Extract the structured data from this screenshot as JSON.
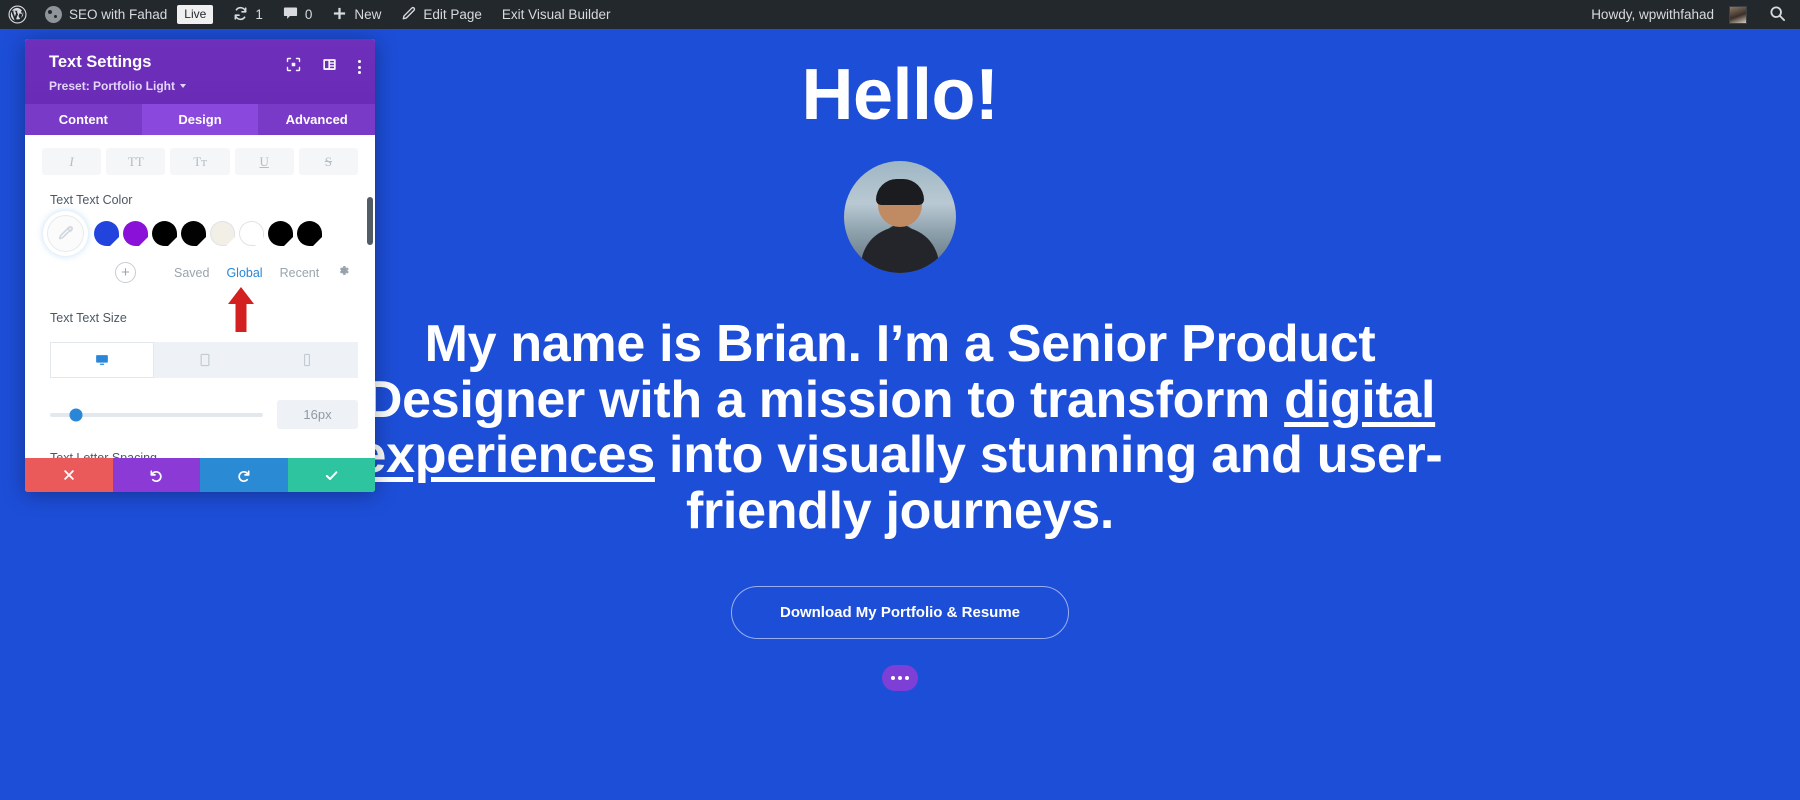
{
  "adminbar": {
    "wp_logo": "wordpress-logo-icon",
    "site_icon": "site-dashboard-icon",
    "site_name": "SEO with Fahad",
    "live_badge": "Live",
    "updates_icon": "updates-icon",
    "updates_count": "1",
    "comments_icon": "comments-icon",
    "comments_count": "0",
    "new_icon": "plus-icon",
    "new_label": "New",
    "edit_icon": "pencil-icon",
    "edit_label": "Edit Page",
    "exit_label": "Exit Visual Builder",
    "howdy": "Howdy, wpwithfahad",
    "avatar": "user-avatar",
    "search_icon": "search-icon"
  },
  "modal": {
    "title": "Text Settings",
    "preset_label": "Preset: Portfolio Light",
    "head_icons": [
      {
        "name": "focus-target-icon"
      },
      {
        "name": "layout-panel-icon"
      },
      {
        "name": "more-options-icon"
      }
    ],
    "tabs": [
      {
        "label": "Content",
        "active": false
      },
      {
        "label": "Design",
        "active": true
      },
      {
        "label": "Advanced",
        "active": false
      }
    ],
    "format_buttons": [
      {
        "name": "italic-button",
        "glyph": "I",
        "style": "it"
      },
      {
        "name": "uppercase-button",
        "glyph": "TT",
        "style": "tt"
      },
      {
        "name": "small-caps-button",
        "glyph": "Tᴛ",
        "style": "tc"
      },
      {
        "name": "underline-button",
        "glyph": "U",
        "style": "un"
      },
      {
        "name": "strikethrough-button",
        "glyph": "S",
        "style": "st"
      }
    ],
    "color_field": {
      "label": "Text Text Color",
      "picker_icon": "eyedropper-icon",
      "swatches": [
        {
          "name": "swatch-blue",
          "color": "#2244dd"
        },
        {
          "name": "swatch-purple",
          "color": "#8a12d8"
        },
        {
          "name": "swatch-black-1",
          "color": "#000000"
        },
        {
          "name": "swatch-black-2",
          "color": "#020202"
        },
        {
          "name": "swatch-cream",
          "color": "#f2efe6"
        },
        {
          "name": "swatch-white",
          "color": "#ffffff"
        },
        {
          "name": "swatch-black-3",
          "color": "#000000"
        },
        {
          "name": "swatch-black-4",
          "color": "#000000"
        }
      ],
      "add_button": "+",
      "source_tabs": [
        {
          "label": "Saved",
          "active": false
        },
        {
          "label": "Global",
          "active": true
        },
        {
          "label": "Recent",
          "active": false
        }
      ],
      "settings_icon": "gear-icon",
      "active_color": "#2a86d8"
    },
    "size_field": {
      "label": "Text Text Size",
      "devices": [
        {
          "name": "desktop-icon",
          "active": true
        },
        {
          "name": "tablet-icon",
          "active": false
        },
        {
          "name": "phone-icon",
          "active": false
        }
      ],
      "slider_percent": 12,
      "value": "16px"
    },
    "letter_spacing_label": "Text Letter Spacing",
    "footer_buttons": [
      {
        "name": "cancel-button",
        "icon": "close-icon",
        "color": "#eb5a5a"
      },
      {
        "name": "undo-button",
        "icon": "undo-icon",
        "color": "#8b3ad6"
      },
      {
        "name": "redo-button",
        "icon": "redo-icon",
        "color": "#2a8ad4"
      },
      {
        "name": "save-button",
        "icon": "check-icon",
        "color": "#2fc4a0"
      }
    ]
  },
  "annotation": {
    "arrow": "red-up-arrow",
    "color": "#d32020",
    "points_at": "Global"
  },
  "page": {
    "background_color": "#1d4ed8",
    "greeting": "Hello!",
    "avatar": "profile-photo",
    "headline_part1": "My name is Brian. I’m a Senior Product Designer with a mission to transform ",
    "headline_link": "digital experiences",
    "headline_part2": " into visually stunning and user-friendly journeys.",
    "cta_label": "Download My Portfolio & Resume",
    "dots_label": "more-options-dots"
  }
}
